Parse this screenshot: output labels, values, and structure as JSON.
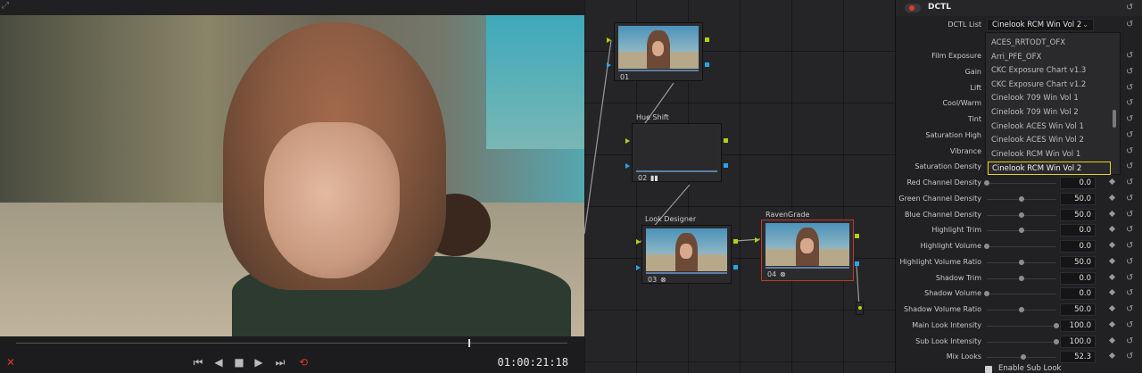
{
  "viewer": {
    "timecode": "01:00:21:18",
    "playhead_fraction": 0.82,
    "icons": [
      "expand-icon",
      "mute-icon",
      "first-frame-icon",
      "step-back-icon",
      "stop-icon",
      "play-icon",
      "last-frame-icon",
      "loop-icon"
    ]
  },
  "nodes": [
    {
      "number": "01",
      "label": ""
    },
    {
      "number": "02",
      "label": "Hue Shift"
    },
    {
      "number": "03",
      "label": "Look Designer"
    },
    {
      "number": "04",
      "label": "RavenGrade"
    }
  ],
  "inspector": {
    "title": "DCTL",
    "dctl_list_label": "DCTL List",
    "dctl_list_value": "Cinelook RCM Win Vol 2",
    "dropdown_options": [
      "ACES_RRTODT_OFX",
      "Arri_PFE_OFX",
      "CKC Exposure Chart v1.3",
      "CKC Exposure Chart v1.2",
      "Cinelook 709 Win Vol 1",
      "Cinelook 709 Win Vol 2",
      "Cinelook ACES Win Vol 1",
      "Cinelook ACES Win Vol 2",
      "Cinelook RCM Win Vol 1",
      "Cinelook RCM Win Vol 2"
    ],
    "selected_option_index": 9,
    "params": [
      {
        "label": "Film Exposure",
        "value": "",
        "knob": null
      },
      {
        "label": "Gain",
        "value": "",
        "knob": null
      },
      {
        "label": "Lift",
        "value": "",
        "knob": null
      },
      {
        "label": "Cool/Warm",
        "value": "",
        "knob": null
      },
      {
        "label": "Tint",
        "value": "",
        "knob": null
      },
      {
        "label": "Saturation High",
        "value": "",
        "knob": null
      },
      {
        "label": "Vibrance",
        "value": "",
        "knob": null
      },
      {
        "label": "Saturation Density",
        "value": "",
        "knob": null
      },
      {
        "label": "Red Channel Density",
        "value": "0.0",
        "knob": 0.0
      },
      {
        "label": "Green Channel Density",
        "value": "50.0",
        "knob": 0.5
      },
      {
        "label": "Blue Channel Density",
        "value": "50.0",
        "knob": 0.5
      },
      {
        "label": "Highlight Trim",
        "value": "0.0",
        "knob": 0.5
      },
      {
        "label": "Highlight Volume",
        "value": "0.0",
        "knob": 0.0
      },
      {
        "label": "Highlight Volume Ratio",
        "value": "50.0",
        "knob": 0.5
      },
      {
        "label": "Shadow Trim",
        "value": "0.0",
        "knob": 0.5
      },
      {
        "label": "Shadow Volume",
        "value": "0.0",
        "knob": 0.0
      },
      {
        "label": "Shadow Volume Ratio",
        "value": "50.0",
        "knob": 0.5
      },
      {
        "label": "Main Look Intensity",
        "value": "100.0",
        "knob": 1.0
      },
      {
        "label": "Sub Look Intensity",
        "value": "100.0",
        "knob": 1.0
      },
      {
        "label": "Mix Looks",
        "value": "52.3",
        "knob": 0.52
      }
    ],
    "enable_sub_look": "Enable Sub Look",
    "accent_color": "#e6d21e",
    "power_color": "#e03a2e"
  }
}
